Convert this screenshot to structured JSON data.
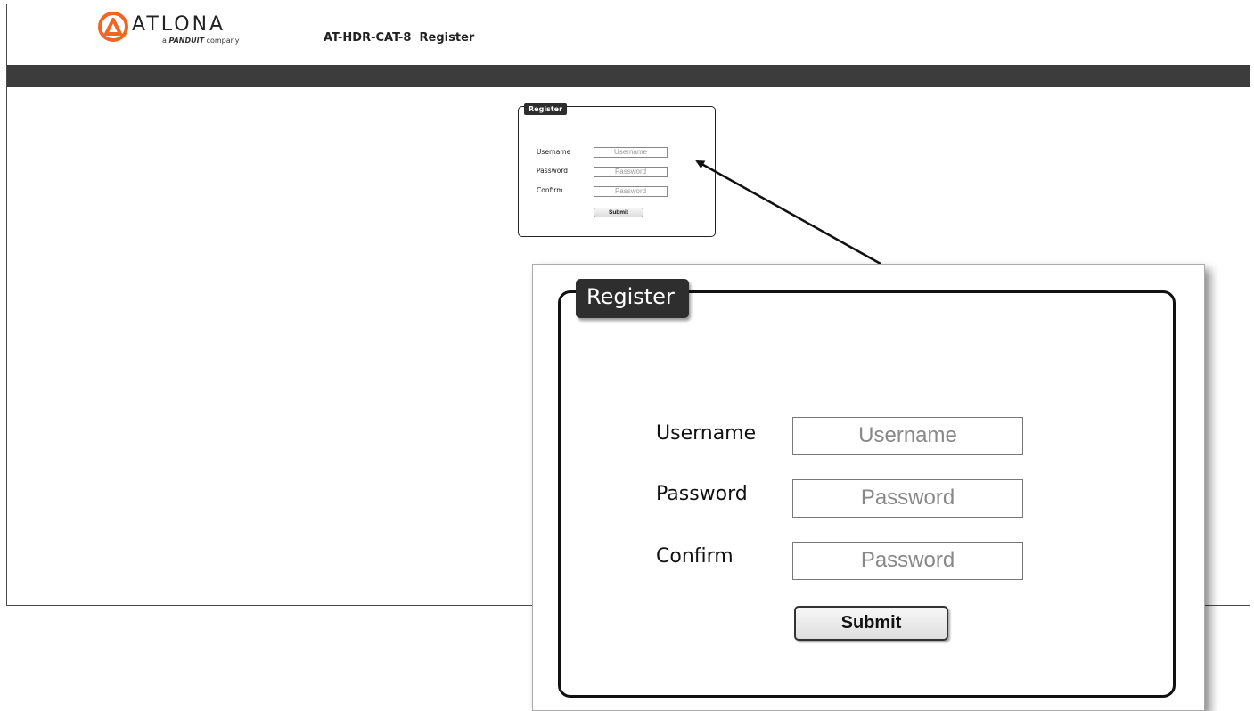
{
  "brand": {
    "name": "ATLONA",
    "tagline_prefix": "a ",
    "tagline_company": "PANDUIT",
    "tagline_suffix": " company",
    "accent_color": "#f26522"
  },
  "header": {
    "model": "AT-HDR-CAT-8",
    "page": "Register"
  },
  "nav_bar": {
    "color": "#3c3c3c"
  },
  "register_form": {
    "legend": "Register",
    "fields": [
      {
        "label": "Username",
        "placeholder": "Username"
      },
      {
        "label": "Password",
        "placeholder": "Password"
      },
      {
        "label": "Confirm",
        "placeholder": "Password"
      }
    ],
    "submit_label": "Submit"
  },
  "zoom_callout": {
    "legend": "Register",
    "fields": [
      {
        "label": "Username",
        "placeholder": "Username"
      },
      {
        "label": "Password",
        "placeholder": "Password"
      },
      {
        "label": "Confirm",
        "placeholder": "Password"
      }
    ],
    "submit_label": "Submit"
  }
}
